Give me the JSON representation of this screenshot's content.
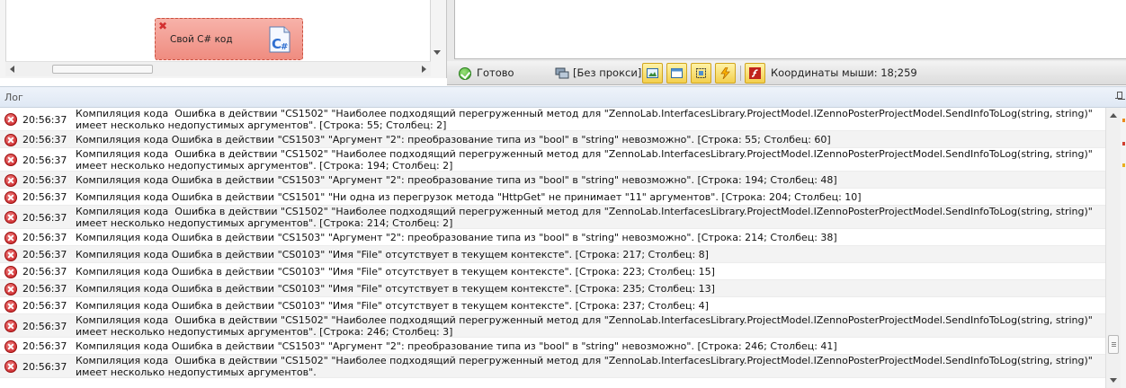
{
  "canvas": {
    "action_block_label": "Свой C# код"
  },
  "status": {
    "ready": "Готово",
    "proxy": "[Без прокси]",
    "coords": "Координаты мыши: 18;259"
  },
  "log": {
    "title": "Лог",
    "rows": [
      {
        "time": "20:56:37",
        "message": "Компиляция кода  Ошибка в действии \"CS1502\" \"Наиболее подходящий перегруженный метод для \"ZennoLab.InterfacesLibrary.ProjectModel.IZennoPosterProjectModel.SendInfoToLog(string, string)\" имеет несколько недопустимых аргументов\". [Строка: 55; Столбец: 2]"
      },
      {
        "time": "20:56:37",
        "message": "Компиляция кода  Ошибка в действии \"CS1503\" \"Аргумент \"2\": преобразование типа из \"bool\" в \"string\" невозможно\". [Строка: 55; Столбец: 60]"
      },
      {
        "time": "20:56:37",
        "message": "Компиляция кода  Ошибка в действии \"CS1502\" \"Наиболее подходящий перегруженный метод для \"ZennoLab.InterfacesLibrary.ProjectModel.IZennoPosterProjectModel.SendInfoToLog(string, string)\" имеет несколько недопустимых аргументов\". [Строка: 194; Столбец: 2]"
      },
      {
        "time": "20:56:37",
        "message": "Компиляция кода  Ошибка в действии \"CS1503\" \"Аргумент \"2\": преобразование типа из \"bool\" в \"string\" невозможно\". [Строка: 194; Столбец: 48]"
      },
      {
        "time": "20:56:37",
        "message": "Компиляция кода  Ошибка в действии \"CS1501\" \"Ни одна из перегрузок метода \"HttpGet\" не принимает \"11\" аргументов\". [Строка: 204; Столбец: 10]"
      },
      {
        "time": "20:56:37",
        "message": "Компиляция кода  Ошибка в действии \"CS1502\" \"Наиболее подходящий перегруженный метод для \"ZennoLab.InterfacesLibrary.ProjectModel.IZennoPosterProjectModel.SendInfoToLog(string, string)\" имеет несколько недопустимых аргументов\". [Строка: 214; Столбец: 2]"
      },
      {
        "time": "20:56:37",
        "message": "Компиляция кода  Ошибка в действии \"CS1503\" \"Аргумент \"2\": преобразование типа из \"bool\" в \"string\" невозможно\". [Строка: 214; Столбец: 38]"
      },
      {
        "time": "20:56:37",
        "message": "Компиляция кода  Ошибка в действии \"CS0103\" \"Имя \"File\" отсутствует в текущем контексте\". [Строка: 217; Столбец: 8]"
      },
      {
        "time": "20:56:37",
        "message": "Компиляция кода  Ошибка в действии \"CS0103\" \"Имя \"File\" отсутствует в текущем контексте\". [Строка: 223; Столбец: 15]"
      },
      {
        "time": "20:56:37",
        "message": "Компиляция кода  Ошибка в действии \"CS0103\" \"Имя \"File\" отсутствует в текущем контексте\". [Строка: 235; Столбец: 13]"
      },
      {
        "time": "20:56:37",
        "message": "Компиляция кода  Ошибка в действии \"CS0103\" \"Имя \"File\" отсутствует в текущем контексте\". [Строка: 237; Столбец: 4]"
      },
      {
        "time": "20:56:37",
        "message": "Компиляция кода  Ошибка в действии \"CS1502\" \"Наиболее подходящий перегруженный метод для \"ZennoLab.InterfacesLibrary.ProjectModel.IZennoPosterProjectModel.SendInfoToLog(string, string)\" имеет несколько недопустимых аргументов\". [Строка: 246; Столбец: 3]"
      },
      {
        "time": "20:56:37",
        "message": "Компиляция кода  Ошибка в действии \"CS1503\" \"Аргумент \"2\": преобразование типа из \"bool\" в \"string\" невозможно\". [Строка: 246; Столбец: 41]"
      },
      {
        "time": "20:56:37",
        "message": "Компиляция кода  Ошибка в действии \"CS1502\" \"Наиболее подходящий перегруженный метод для \"ZennoLab.InterfacesLibrary.ProjectModel.IZennoPosterProjectModel.SendInfoToLog(string, string)\" имеет несколько недопустимых аргументов\"."
      }
    ]
  }
}
